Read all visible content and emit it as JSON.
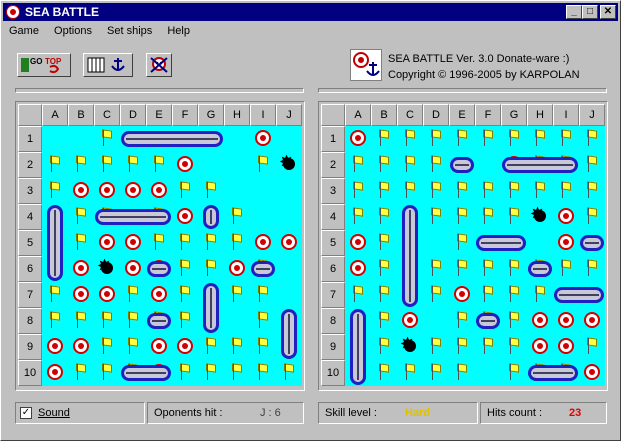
{
  "window": {
    "title": "SEA BATTLE"
  },
  "title_buttons": [
    "_",
    "□",
    "✕"
  ],
  "menu": [
    {
      "label": "Game",
      "underline": "G"
    },
    {
      "label": "Options",
      "underline": "O"
    },
    {
      "label": "Set ships",
      "underline": "S"
    },
    {
      "label": "Help",
      "underline": "H"
    }
  ],
  "toolbar": {
    "go_top_labels": [
      "GO",
      "TOP"
    ],
    "buttons": [
      "go-button",
      "top-button",
      "set-ships-button",
      "anchor-button",
      "skull-button"
    ]
  },
  "info": {
    "line1": "SEA BATTLE Ver. 3.0  Donate-ware :)",
    "line2": "Copyright © 1996-2005 by KARPOLAN"
  },
  "columns": [
    "A",
    "B",
    "C",
    "D",
    "E",
    "F",
    "G",
    "H",
    "I",
    "J"
  ],
  "rows": [
    "1",
    "2",
    "3",
    "4",
    "5",
    "6",
    "7",
    "8",
    "9",
    "10"
  ],
  "left_board": {
    "grid": [
      "..F.....B.",
      "FFFFFB..FX",
      "FBBBBFF...",
      "BFF.FBBF..",
      "BFBBFFFFBB",
      "FBXBBFFBF.",
      "FBBFBFBFF.",
      "FFFFFFF.FF",
      "BBFFBBFFF.",
      "BFFFBFFFFF"
    ],
    "ships": [
      {
        "r": 1,
        "c": 3,
        "len": 4,
        "dir": "h"
      },
      {
        "r": 4,
        "c": 2,
        "len": 3,
        "dir": "h"
      },
      {
        "r": 4,
        "c": 0,
        "len": 3,
        "dir": "v"
      },
      {
        "r": 6,
        "c": 4,
        "len": 1,
        "dir": "h"
      },
      {
        "r": 6,
        "c": 8,
        "len": 1,
        "dir": "h"
      },
      {
        "r": 7,
        "c": 6,
        "len": 2,
        "dir": "v"
      },
      {
        "r": 8,
        "c": 4,
        "len": 1,
        "dir": "h"
      },
      {
        "r": 8,
        "c": 9,
        "len": 2,
        "dir": "v"
      },
      {
        "r": 10,
        "c": 3,
        "len": 2,
        "dir": "h"
      },
      {
        "r": 4,
        "c": 6,
        "len": 1,
        "dir": "v"
      }
    ]
  },
  "right_board": {
    "grid": [
      "BFFFFFFFFF",
      "FFFF..BFFF",
      "FFFFFFFFFF",
      "FFFFFFFXBF",
      "BFF.F...B.",
      "BFFFFFFFFF",
      "FFFFBFFF..",
      "FFB.FFFBBB",
      "FFXFFFFBBF",
      "FFFFF.FFFB"
    ],
    "ships": [
      {
        "r": 2,
        "c": 4,
        "len": 1,
        "dir": "h"
      },
      {
        "r": 2,
        "c": 6,
        "len": 3,
        "dir": "h"
      },
      {
        "r": 4,
        "c": 2,
        "len": 4,
        "dir": "v"
      },
      {
        "r": 5,
        "c": 5,
        "len": 2,
        "dir": "h"
      },
      {
        "r": 5,
        "c": 9,
        "len": 1,
        "dir": "h"
      },
      {
        "r": 6,
        "c": 7,
        "len": 1,
        "dir": "h"
      },
      {
        "r": 7,
        "c": 8,
        "len": 2,
        "dir": "h"
      },
      {
        "r": 8,
        "c": 0,
        "len": 3,
        "dir": "v"
      },
      {
        "r": 8,
        "c": 5,
        "len": 1,
        "dir": "h"
      },
      {
        "r": 10,
        "c": 7,
        "len": 2,
        "dir": "h"
      }
    ]
  },
  "status": {
    "sound_label": "Sound",
    "sound_checked": "✓",
    "opponents_hit_label": "Oponents hit :",
    "opponents_hit_value": "J : 6",
    "skill_label": "Skill level :",
    "skill_value": "Hard",
    "hits_label": "Hits count :",
    "hits_value": "23"
  },
  "colors": {
    "water": "#00ffff",
    "ship_outline": "#2020c0",
    "skill_value": "#e0c000",
    "hits_value": "#e00000"
  }
}
